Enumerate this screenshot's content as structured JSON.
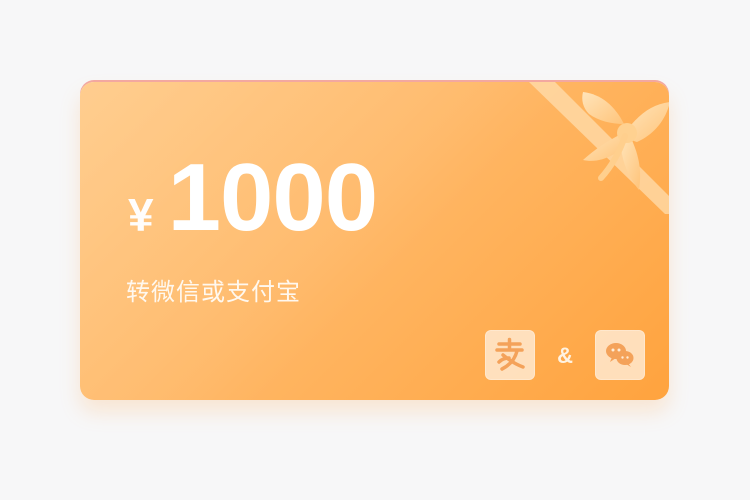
{
  "card": {
    "currency_symbol": "¥",
    "amount": "1000",
    "subtitle": "转微信或支付宝",
    "ampersand": "&"
  },
  "icons": {
    "left": "alipay-icon",
    "right": "wechat-icon",
    "ribbon": "gift-bow-icon"
  },
  "colors": {
    "card_start": "#ffc57c",
    "card_end": "#ffa33e",
    "icon_bg": "#ffecd6",
    "icon_fg": "#f4a25a",
    "text": "#ffffff"
  }
}
